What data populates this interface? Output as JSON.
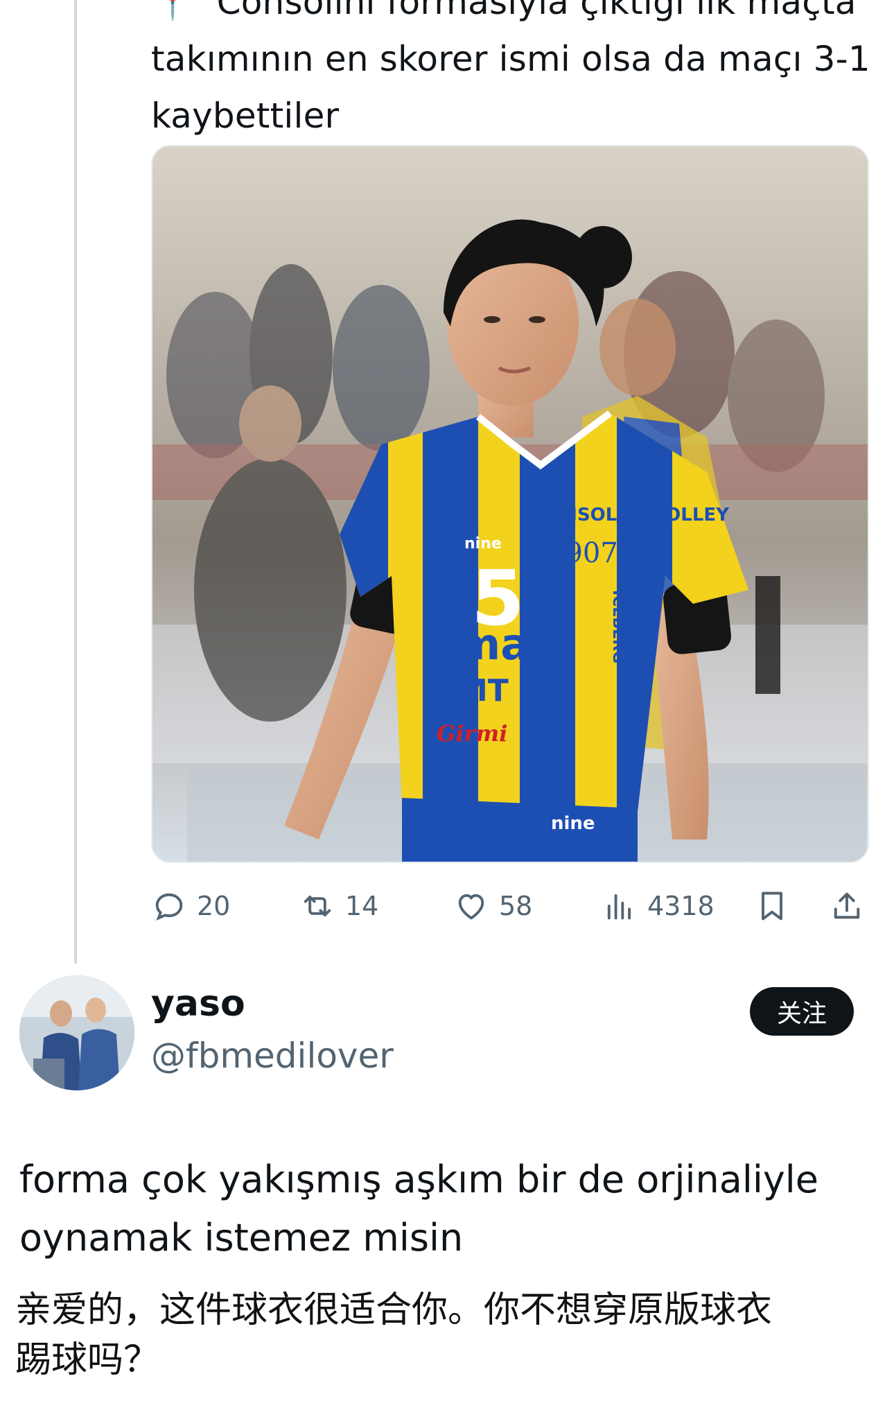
{
  "tweet": {
    "text_lines": [
      "Consolini formasıyla çıktığı ilk maçta",
      "takımının en skorer ismi olsa da maçı 3-1",
      "kaybettiler"
    ],
    "pin_emoji": "📍",
    "media": {
      "jersey_number": "5",
      "jersey_brand": "nine",
      "team_logo_text": "CONSOLINI VOLLEY",
      "year_patch": "1907",
      "sponsor_1": "omaG",
      "sponsor_2": "MT",
      "sponsor_3": "Girmi",
      "sponsor_side": "ICEBERG",
      "shorts_brand": "nine"
    },
    "actions": {
      "replies": "20",
      "retweets": "14",
      "likes": "58",
      "views": "4318"
    }
  },
  "reply": {
    "display_name": "yaso",
    "handle": "@fbmedilover",
    "follow_label": "关注",
    "text_lines": [
      "forma çok yakışmış aşkım bir de orjinaliyle",
      "oynamak istemez misin"
    ],
    "translation_lines": [
      "亲爱的，这件球衣很适合你。你不想穿原版球衣",
      "踢球吗？"
    ]
  },
  "colors": {
    "text": "#0f1419",
    "muted": "#536471",
    "jersey_yellow": "#f2d21c",
    "jersey_blue": "#1d4fb3",
    "thread_line": "#cfd9de"
  }
}
